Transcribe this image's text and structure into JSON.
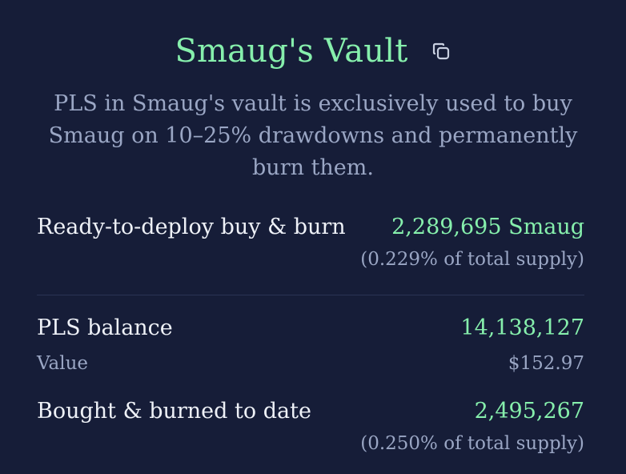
{
  "vault": {
    "title": "Smaug's Vault",
    "copy_icon": "copy-icon",
    "description": "PLS in Smaug's vault is exclusively used to buy Smaug on 10–25% drawdowns and permanently burn them."
  },
  "deploy": {
    "label": "Ready-to-deploy buy & burn",
    "value": "2,289,695 Smaug",
    "supply_note": "(0.229% of total supply)"
  },
  "balance": {
    "label": "PLS balance",
    "value": "14,138,127",
    "value_label": "Value",
    "value_usd": "$152.97"
  },
  "burned": {
    "label": "Bought & burned to date",
    "value": "2,495,267",
    "supply_note": "(0.250% of total supply)"
  },
  "colors": {
    "background": "#161d38",
    "accent_green": "#86efac",
    "muted_text": "#9aa6c4",
    "primary_text": "#eef1f7"
  }
}
